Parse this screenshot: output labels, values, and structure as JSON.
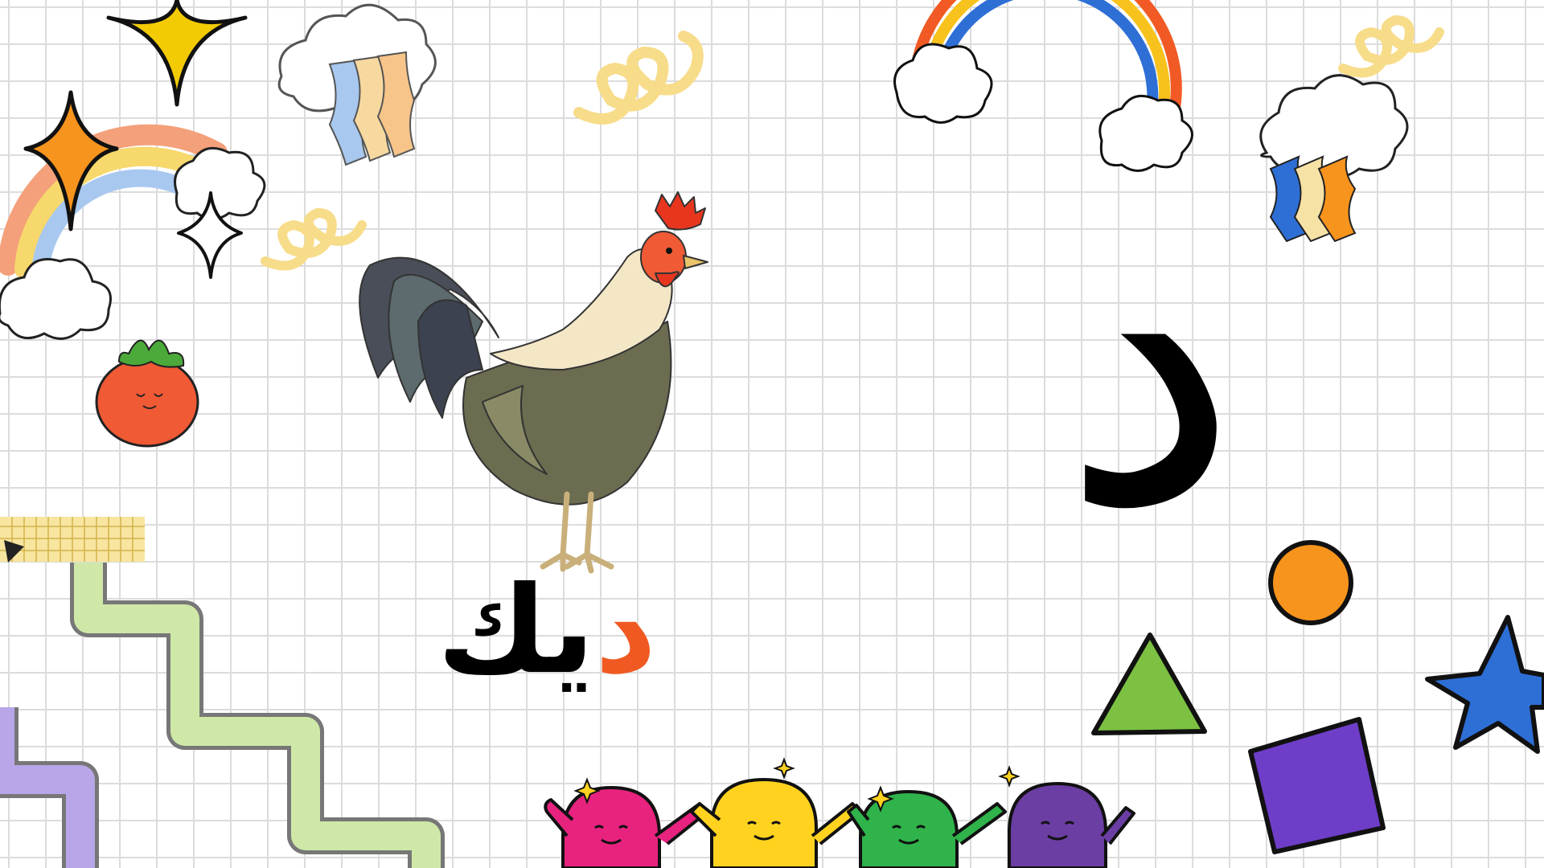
{
  "slide": {
    "letter": "د",
    "word_first_letter": "د",
    "word_rest": "يك",
    "colors": {
      "background": "#ffffff",
      "grid": "#dcdcdc",
      "letter": "#000000",
      "word_highlight": "#f05a22",
      "word": "#000000"
    }
  },
  "decorations": {
    "icons": [
      "rainbow-icon",
      "cloud-icon",
      "sparkle-star-icon",
      "spiral-squiggle-icon",
      "tomato-icon",
      "rooster-illustration",
      "grid-tape-icon",
      "zigzag-ribbon-icon",
      "orange-circle-icon",
      "green-triangle-icon",
      "blue-star-icon",
      "purple-square-icon",
      "smiling-characters-icon"
    ]
  }
}
